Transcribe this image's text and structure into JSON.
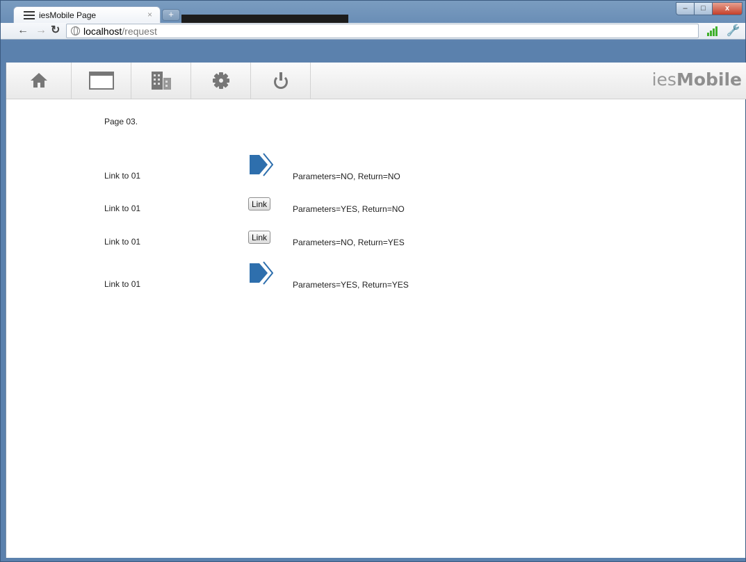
{
  "browser": {
    "tab_title": "iesMobile Page",
    "tab_close": "×",
    "new_tab": "+",
    "url_host": "localhost",
    "url_path": "/request",
    "window_buttons": {
      "minimize": "–",
      "maximize": "□",
      "close": "x"
    }
  },
  "appbar": {
    "title_prefix": "ies",
    "title_bold": "Mobile",
    "buttons": [
      {
        "name": "home",
        "icon": "home-icon"
      },
      {
        "name": "window",
        "icon": "window-icon"
      },
      {
        "name": "building",
        "icon": "building-icon"
      },
      {
        "name": "settings",
        "icon": "gear-icon"
      },
      {
        "name": "power",
        "icon": "power-icon"
      }
    ]
  },
  "content": {
    "page_label": "Page 03.",
    "rows": [
      {
        "label": "Link to 01",
        "control": "arrow-icon",
        "description": "Parameters=NO, Return=NO"
      },
      {
        "label": "Link to 01",
        "control": "button",
        "button_label": "Link",
        "description": "Parameters=YES, Return=NO"
      },
      {
        "label": "Link to 01",
        "control": "button",
        "button_label": "Link",
        "description": "Parameters=NO, Return=YES"
      },
      {
        "label": "Link to 01",
        "control": "arrow-icon",
        "description": "Parameters=YES, Return=YES"
      }
    ]
  },
  "colors": {
    "arrow_blue": "#2e6fad",
    "toolbar_icon": "#777777",
    "signal_green": "#3fb02a"
  }
}
